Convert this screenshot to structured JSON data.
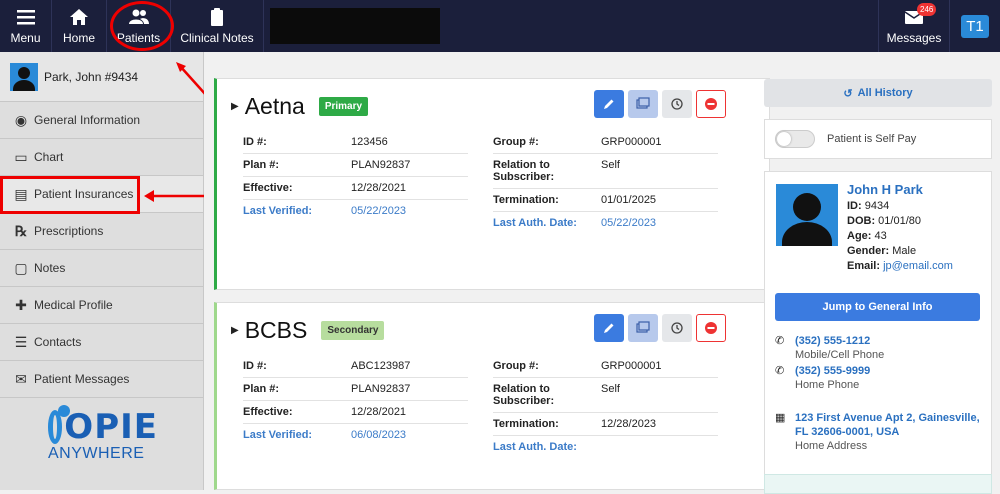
{
  "topbar": {
    "menu": "Menu",
    "home": "Home",
    "patients": "Patients",
    "clinical_notes": "Clinical Notes",
    "messages": "Messages",
    "messages_count": "246",
    "user_initials": "T1"
  },
  "sidebar": {
    "patient_name": "Park, John #9434",
    "items": [
      {
        "label": "General Information",
        "icon": "user-circle-icon"
      },
      {
        "label": "Chart",
        "icon": "folder-icon"
      },
      {
        "label": "Patient Insurances",
        "icon": "id-card-icon"
      },
      {
        "label": "Prescriptions",
        "icon": "rx-icon"
      },
      {
        "label": "Notes",
        "icon": "note-icon"
      },
      {
        "label": "Medical Profile",
        "icon": "medical-icon"
      },
      {
        "label": "Contacts",
        "icon": "contact-icon"
      },
      {
        "label": "Patient Messages",
        "icon": "envelope-icon"
      }
    ],
    "logo_top": "OPIE",
    "logo_bottom": "ANYWHERE"
  },
  "insurances": [
    {
      "name": "Aetna",
      "tag": "Primary",
      "left": [
        {
          "label": "ID #:",
          "value": "123456"
        },
        {
          "label": "Plan #:",
          "value": "PLAN92837"
        },
        {
          "label": "Effective:",
          "value": "12/28/2021"
        },
        {
          "label": "Last Verified:",
          "value": "05/22/2023"
        }
      ],
      "right": [
        {
          "label": "Group #:",
          "value": "GRP000001"
        },
        {
          "label": "Relation to Subscriber:",
          "value": "Self"
        },
        {
          "label": "Termination:",
          "value": "01/01/2025"
        },
        {
          "label": "Last Auth. Date:",
          "value": "05/22/2023"
        }
      ]
    },
    {
      "name": "BCBS",
      "tag": "Secondary",
      "left": [
        {
          "label": "ID #:",
          "value": "ABC123987"
        },
        {
          "label": "Plan #:",
          "value": "PLAN92837"
        },
        {
          "label": "Effective:",
          "value": "12/28/2021"
        },
        {
          "label": "Last Verified:",
          "value": "06/08/2023"
        }
      ],
      "right": [
        {
          "label": "Group #:",
          "value": "GRP000001"
        },
        {
          "label": "Relation to Subscriber:",
          "value": "Self"
        },
        {
          "label": "Termination:",
          "value": "12/28/2023"
        },
        {
          "label": "Last Auth. Date:",
          "value": ""
        }
      ]
    }
  ],
  "right_panel": {
    "all_history": "All History",
    "self_pay_label": "Patient is Self Pay",
    "patient": {
      "name": "John H Park",
      "id_label": "ID:",
      "id": "9434",
      "dob_label": "DOB:",
      "dob": "01/01/80",
      "age_label": "Age:",
      "age": "43",
      "gender_label": "Gender:",
      "gender": "Male",
      "email_label": "Email:",
      "email": "jp@email.com"
    },
    "jump_button": "Jump to General Info",
    "phones": [
      {
        "number": "(352) 555-1212",
        "type": "Mobile/Cell Phone"
      },
      {
        "number": "(352) 555-9999",
        "type": "Home Phone"
      }
    ],
    "address": {
      "line1": "123 First Avenue Apt 2, Gainesville,",
      "line2": "FL 32606-0001, USA",
      "type": "Home Address"
    }
  },
  "colors": {
    "nav_bg": "#1b1f3b",
    "accent": "#3b7be0",
    "primary_tag": "#2eaa46",
    "secondary_tag": "#b7dd9e",
    "annotation": "#e00000"
  }
}
